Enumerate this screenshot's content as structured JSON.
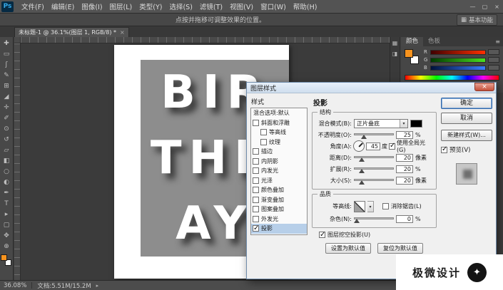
{
  "app": {
    "logo": "Ps"
  },
  "icons": {
    "workspace": "▦",
    "menu": "≡",
    "tab_close": "×",
    "dropdown": "▾",
    "status_arrow": "▸",
    "dock_a": "▦",
    "dock_b": "◨",
    "logo_glyph": "✦"
  },
  "colors": {
    "foreground_swatch": "#f7931e",
    "blend_color_swatch": "#000000",
    "artwork_background": "#8d8d8d"
  },
  "menubar": {
    "items": [
      "文件(F)",
      "编辑(E)",
      "图像(I)",
      "图层(L)",
      "类型(Y)",
      "选择(S)",
      "滤镜(T)",
      "视图(V)",
      "窗口(W)",
      "帮助(H)"
    ],
    "minimize": "—",
    "maximize": "▢",
    "close": "×"
  },
  "options_bar": {
    "hint": "点按并拖移可调整效果的位置。",
    "workspace": "基本功能"
  },
  "tab": {
    "title": "未标题-1 @ 36.1%(图层 1, RGB/8) *"
  },
  "toolbar": {
    "tools": [
      {
        "name": "move-tool",
        "glyph": "✚"
      },
      {
        "name": "rectangular-marquee-tool",
        "glyph": "▭"
      },
      {
        "name": "lasso-tool",
        "glyph": "ʃ"
      },
      {
        "name": "quick-selection-tool",
        "glyph": "✎"
      },
      {
        "name": "crop-tool",
        "glyph": "⊞"
      },
      {
        "name": "eyedropper-tool",
        "glyph": "◢"
      },
      {
        "name": "healing-brush-tool",
        "glyph": "✛"
      },
      {
        "name": "brush-tool",
        "glyph": "✐"
      },
      {
        "name": "clone-stamp-tool",
        "glyph": "⊙"
      },
      {
        "name": "history-brush-tool",
        "glyph": "↺"
      },
      {
        "name": "eraser-tool",
        "glyph": "▱"
      },
      {
        "name": "gradient-tool",
        "glyph": "◧"
      },
      {
        "name": "blur-tool",
        "glyph": "○"
      },
      {
        "name": "dodge-tool",
        "glyph": "◐"
      },
      {
        "name": "pen-tool",
        "glyph": "✒"
      },
      {
        "name": "type-tool",
        "glyph": "T"
      },
      {
        "name": "path-selection-tool",
        "glyph": "▸"
      },
      {
        "name": "shape-tool",
        "glyph": "▢"
      },
      {
        "name": "hand-tool",
        "glyph": "✥"
      },
      {
        "name": "zoom-tool",
        "glyph": "⊕"
      }
    ]
  },
  "canvas": {
    "lines": [
      "BIR",
      "THD",
      "AY"
    ]
  },
  "color_panel": {
    "tabs": [
      "颜色",
      "色板"
    ],
    "channels": [
      {
        "label": "R"
      },
      {
        "label": "G"
      },
      {
        "label": "B"
      }
    ]
  },
  "dialog": {
    "title": "图层样式",
    "close": "×",
    "styles": {
      "header": "样式",
      "blending_options": "混合选项:默认",
      "items": [
        {
          "label": "斜面和浮雕",
          "checked": false
        },
        {
          "label": "等高线",
          "checked": false
        },
        {
          "label": "纹理",
          "checked": false
        },
        {
          "label": "描边",
          "checked": false
        },
        {
          "label": "内阴影",
          "checked": false
        },
        {
          "label": "内发光",
          "checked": false
        },
        {
          "label": "光泽",
          "checked": false
        },
        {
          "label": "颜色叠加",
          "checked": false
        },
        {
          "label": "渐变叠加",
          "checked": false
        },
        {
          "label": "图案叠加",
          "checked": false
        },
        {
          "label": "外发光",
          "checked": false
        },
        {
          "label": "投影",
          "checked": true
        }
      ]
    },
    "shadow": {
      "title": "投影",
      "structure_legend": "结构",
      "blend_mode_label": "混合模式(B):",
      "blend_mode_value": "正片叠底",
      "opacity_label": "不透明度(O):",
      "opacity_value": "25",
      "opacity_unit": "%",
      "angle_label": "角度(A):",
      "angle_value": "45",
      "angle_unit": "度",
      "global_light_label": "使用全局光(G)",
      "global_light_checked": true,
      "distance_label": "距离(D):",
      "distance_value": "20",
      "distance_unit": "像素",
      "spread_label": "扩展(R):",
      "spread_value": "20",
      "spread_unit": "%",
      "size_label": "大小(S):",
      "size_value": "20",
      "size_unit": "像素",
      "quality_legend": "品质",
      "contour_label": "等高线:",
      "antialias_label": "消除锯齿(L)",
      "antialias_checked": false,
      "noise_label": "杂色(N):",
      "noise_value": "0",
      "noise_unit": "%",
      "knockout_label": "图层挖空投影(U)",
      "knockout_checked": true,
      "make_default": "设置为默认值",
      "reset_default": "复位为默认值"
    },
    "actions": {
      "ok": "确定",
      "cancel": "取消",
      "new_style": "新建样式(W)...",
      "preview_label": "预览(V)",
      "preview_checked": true
    }
  },
  "status_bar": {
    "zoom": "36.08%",
    "doc_info": "文档:5.51M/15.2M"
  },
  "watermark": {
    "text": "极微设计"
  }
}
